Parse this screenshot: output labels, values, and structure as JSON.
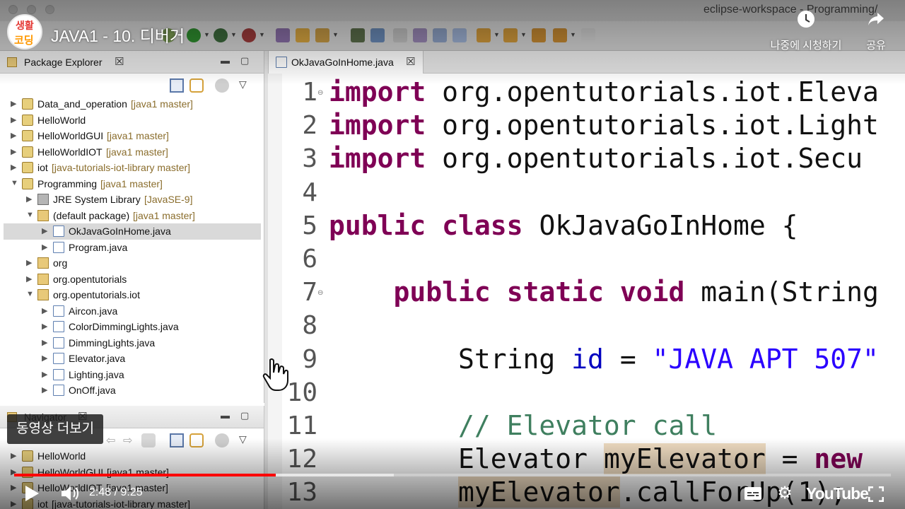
{
  "window": {
    "title": "eclipse-workspace - Programming/"
  },
  "package_explorer": {
    "title": "Package Explorer",
    "items": [
      {
        "label": "Data_and_operation",
        "tag": "[java1 master]",
        "indent": 0,
        "twisty": "collapsed",
        "icon": "project-icon"
      },
      {
        "label": "HelloWorld",
        "tag": "",
        "indent": 0,
        "twisty": "collapsed",
        "icon": "project-icon"
      },
      {
        "label": "HelloWorldGUI",
        "tag": "[java1 master]",
        "indent": 0,
        "twisty": "collapsed",
        "icon": "project-icon"
      },
      {
        "label": "HelloWorldIOT",
        "tag": "[java1 master]",
        "indent": 0,
        "twisty": "collapsed",
        "icon": "project-icon"
      },
      {
        "label": "iot",
        "tag": "[java-tutorials-iot-library master]",
        "indent": 0,
        "twisty": "collapsed",
        "icon": "project-icon"
      },
      {
        "label": "Programming",
        "tag": "[java1 master]",
        "indent": 0,
        "twisty": "expanded",
        "icon": "project-icon"
      },
      {
        "label": "JRE System Library",
        "tag": "[JavaSE-9]",
        "indent": 1,
        "twisty": "collapsed",
        "icon": "library-icon"
      },
      {
        "label": "(default package)",
        "tag": "[java1 master]",
        "indent": 1,
        "twisty": "expanded",
        "icon": "package-icon"
      },
      {
        "label": "OkJavaGoInHome.java",
        "tag": "",
        "indent": 2,
        "twisty": "collapsed",
        "icon": "java-file-icon",
        "selected": true
      },
      {
        "label": "Program.java",
        "tag": "",
        "indent": 2,
        "twisty": "collapsed",
        "icon": "java-file-icon"
      },
      {
        "label": "org",
        "tag": "",
        "indent": 1,
        "twisty": "collapsed",
        "icon": "package-icon"
      },
      {
        "label": "org.opentutorials",
        "tag": "",
        "indent": 1,
        "twisty": "collapsed",
        "icon": "package-icon"
      },
      {
        "label": "org.opentutorials.iot",
        "tag": "",
        "indent": 1,
        "twisty": "expanded",
        "icon": "package-icon"
      },
      {
        "label": "Aircon.java",
        "tag": "",
        "indent": 2,
        "twisty": "collapsed",
        "icon": "java-file-icon"
      },
      {
        "label": "ColorDimmingLights.java",
        "tag": "",
        "indent": 2,
        "twisty": "collapsed",
        "icon": "java-file-icon"
      },
      {
        "label": "DimmingLights.java",
        "tag": "",
        "indent": 2,
        "twisty": "collapsed",
        "icon": "java-file-icon"
      },
      {
        "label": "Elevator.java",
        "tag": "",
        "indent": 2,
        "twisty": "collapsed",
        "icon": "java-file-icon"
      },
      {
        "label": "Lighting.java",
        "tag": "",
        "indent": 2,
        "twisty": "collapsed",
        "icon": "java-file-icon"
      },
      {
        "label": "OnOff.java",
        "tag": "",
        "indent": 2,
        "twisty": "collapsed",
        "icon": "java-file-icon"
      }
    ]
  },
  "navigator": {
    "title": "Navigator",
    "items": [
      {
        "label": "HelloWorld",
        "tag": ""
      },
      {
        "label": "HelloWorldGUI",
        "tag": "[java1 master]"
      },
      {
        "label": "HelloWorldIOT",
        "tag": "[java1 master]"
      },
      {
        "label": "iot",
        "tag": "[java-tutorials-iot-library master]"
      }
    ]
  },
  "editor": {
    "tab_label": "OkJavaGoInHome.java",
    "lines": [
      {
        "n": "1",
        "fold": true,
        "parts": [
          {
            "t": "import",
            "c": "kw"
          },
          {
            "t": " org.opentutorials.iot.Eleva",
            "c": ""
          }
        ]
      },
      {
        "n": "2",
        "fold": false,
        "parts": [
          {
            "t": "import",
            "c": "kw"
          },
          {
            "t": " org.opentutorials.iot.Light",
            "c": ""
          }
        ]
      },
      {
        "n": "3",
        "fold": false,
        "parts": [
          {
            "t": "import",
            "c": "kw"
          },
          {
            "t": " org.opentutorials.iot.Secu",
            "c": ""
          }
        ]
      },
      {
        "n": "4",
        "fold": false,
        "parts": []
      },
      {
        "n": "5",
        "fold": false,
        "parts": [
          {
            "t": "public",
            "c": "kw"
          },
          {
            "t": " ",
            "c": ""
          },
          {
            "t": "class",
            "c": "kw"
          },
          {
            "t": " OkJavaGoInHome {",
            "c": ""
          }
        ]
      },
      {
        "n": "6",
        "fold": false,
        "parts": []
      },
      {
        "n": "7",
        "fold": true,
        "parts": [
          {
            "t": "    ",
            "c": ""
          },
          {
            "t": "public",
            "c": "kw"
          },
          {
            "t": " ",
            "c": ""
          },
          {
            "t": "static",
            "c": "kw"
          },
          {
            "t": " ",
            "c": ""
          },
          {
            "t": "void",
            "c": "kw"
          },
          {
            "t": " main(String",
            "c": ""
          }
        ]
      },
      {
        "n": "8",
        "fold": false,
        "parts": []
      },
      {
        "n": "9",
        "fold": false,
        "parts": [
          {
            "t": "        String ",
            "c": ""
          },
          {
            "t": "id",
            "c": "var"
          },
          {
            "t": " = ",
            "c": ""
          },
          {
            "t": "\"JAVA APT 507\"",
            "c": "str"
          }
        ]
      },
      {
        "n": "10",
        "fold": false,
        "parts": []
      },
      {
        "n": "11",
        "fold": false,
        "parts": [
          {
            "t": "        ",
            "c": ""
          },
          {
            "t": "// Elevator call",
            "c": "cm"
          }
        ]
      },
      {
        "n": "12",
        "fold": false,
        "parts": [
          {
            "t": "        Elevator ",
            "c": ""
          },
          {
            "t": "myElevator",
            "c": "occ"
          },
          {
            "t": " = ",
            "c": ""
          },
          {
            "t": "new",
            "c": "kw"
          }
        ]
      },
      {
        "n": "13",
        "fold": false,
        "parts": [
          {
            "t": "        ",
            "c": ""
          },
          {
            "t": "myElevator",
            "c": "occ"
          },
          {
            "t": ".callForUp(1);",
            "c": ""
          }
        ]
      }
    ]
  },
  "youtube": {
    "channel_avatar_text_1": "생활",
    "channel_avatar_text_2": "코딩",
    "video_title": "JAVA1 - 10. 디버거",
    "watch_later_label": "나중에 시청하기",
    "share_label": "공유",
    "more_videos_label": "동영상 더보기",
    "current_time": "2:48",
    "duration": "9:25",
    "time_display": "2:48 / 9:25",
    "played_fraction": 0.298,
    "buffered_fraction": 0.433,
    "logo_text": "YouTube"
  }
}
